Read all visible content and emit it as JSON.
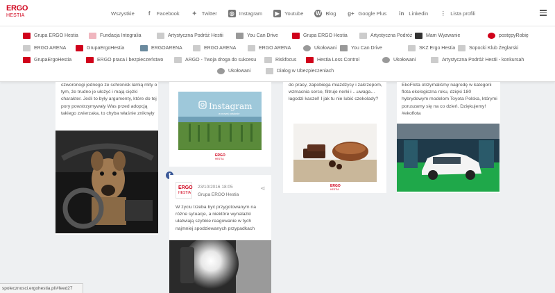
{
  "logo": {
    "line1": "ERGO",
    "line2": "HESTIA"
  },
  "nav": {
    "items": [
      {
        "label": "Wszystkie",
        "icon": "none"
      },
      {
        "label": "Facebook",
        "icon": "facebook-icon"
      },
      {
        "label": "Twitter",
        "icon": "twitter-icon"
      },
      {
        "label": "Instagram",
        "icon": "instagram-icon"
      },
      {
        "label": "Youtube",
        "icon": "youtube-icon"
      },
      {
        "label": "Blog",
        "icon": "wordpress-icon"
      },
      {
        "label": "Google Plus",
        "icon": "google-plus-icon"
      },
      {
        "label": "Linkedin",
        "icon": "linkedin-icon"
      },
      {
        "label": "Lista profili",
        "icon": "vertical-dots-icon"
      }
    ]
  },
  "dropdown": {
    "items": [
      "Grupa ERGO Hestia",
      "Fundacja Integralia",
      "Artystyczna Podróż Hestii",
      "You Can Drive",
      "Grupa ERGO Hestia",
      "Artystyczna Podróż",
      "Mam Wyzwanie",
      "postępyRobię",
      "ERGO ARENA",
      "GrupaErgoHestia",
      "ERGOARENA",
      "ERGO ARENA",
      "ERGO ARENA",
      "Ukołowani",
      "You Can Drive",
      "SKZ Ergo Hestia",
      "Sopocki Klub Żeglarski",
      "GrupaErgoHestia",
      "ERGO praca i bezpieczeństwo",
      "ARGO - Twoja droga do sukcesu",
      "Riskfocus",
      "Hestia Loss Control",
      "Ukołowani",
      "Artystyczna Podróż Hestii - konkursah",
      "Ukołowani",
      "Dialog w Ubezpieczeniach"
    ]
  },
  "feed": {
    "col1_text": "czworonogi jednego ze schronisk łamią mity o tym, że trudno je ułożyć i mają ciężki charakter. Jeśli to były argumenty, które do tej pory powstrzymywały Was przed adopcją takiego zwierzaka, to chyba właśnie zniknęły",
    "instagram_word": "Instagram",
    "instagram_sub": "w nowej odsłonie",
    "card2": {
      "date": "23/10/2016 18:05",
      "author": "Grupa ERGO Hestia",
      "text": "W życiu trzeba być przygotowanym na różne sytuacje, a niektóre wynalazki ułatwiają szybkie reagowanie w tych najmniej spodziewanych przypadkach"
    },
    "col3_text": "do pracy, zapobiega miażdżycy i zakrzepom, wzmacnia serce, filtruje nerki i ...uwaga… łagodzi kaszel! I jak tu nie lubić czekolady?",
    "col4_text": "EkoFlota otrzymaliśmy nagrodę w kategorii flota ekologiczna roku, dzięki 180 hybrydowym modelom Toyota Polska, którymi poruszamy się na co dzień. Dziękujemy! #ekoflota"
  },
  "statusbar": {
    "url": "spolecznosci.ergohestia.pl/#feed27"
  }
}
